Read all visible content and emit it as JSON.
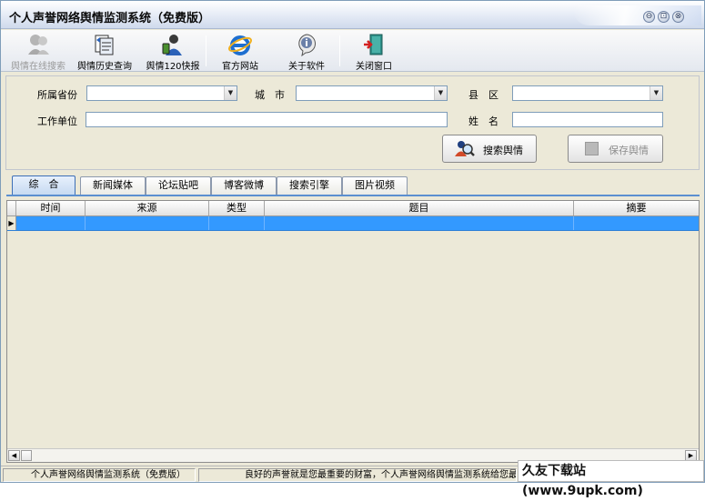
{
  "window": {
    "title": "个人声誉网络舆情监测系统（免费版）",
    "controls": [
      "⊖",
      "⊡",
      "⊗"
    ]
  },
  "toolbar": {
    "items": [
      {
        "label": "舆情在线搜索",
        "icon": "users-icon",
        "enabled": false
      },
      {
        "label": "舆情历史查询",
        "icon": "history-icon",
        "enabled": true
      },
      {
        "label": "舆情120快报",
        "icon": "report-icon",
        "enabled": true
      },
      {
        "label": "官方网站",
        "icon": "ie-icon",
        "enabled": true
      },
      {
        "label": "关于软件",
        "icon": "info-icon",
        "enabled": true
      },
      {
        "label": "关闭窗口",
        "icon": "exit-door-icon",
        "enabled": true
      }
    ]
  },
  "form": {
    "province_label": "所属省份",
    "province_value": "",
    "city_label": "城　市",
    "city_value": "",
    "county_label": "县　区",
    "county_value": "",
    "workplace_label": "工作单位",
    "workplace_value": "",
    "name_label": "姓　名",
    "name_value": "",
    "search_button": "搜索舆情",
    "save_button": "保存舆情"
  },
  "tabs": [
    "综　合",
    "新闻媒体",
    "论坛贴吧",
    "博客微博",
    "搜索引擎",
    "图片视频"
  ],
  "active_tab": 0,
  "grid": {
    "columns": [
      "时间",
      "来源",
      "类型",
      "题目",
      "摘要"
    ],
    "rows": [
      [
        "",
        "",
        "",
        "",
        ""
      ]
    ]
  },
  "status": {
    "app_name": "个人声誉网络舆情监测系统（免费版）",
    "message": "良好的声誉就是您最重要的财富，个人声誉网络舆情监测系统给您最贴心的帮"
  },
  "watermark": "久友下载站(www.9upk.com)",
  "colors": {
    "selection": "#3399ff",
    "tab_active": "#c5d9f1",
    "window_bg": "#ece9d8"
  }
}
